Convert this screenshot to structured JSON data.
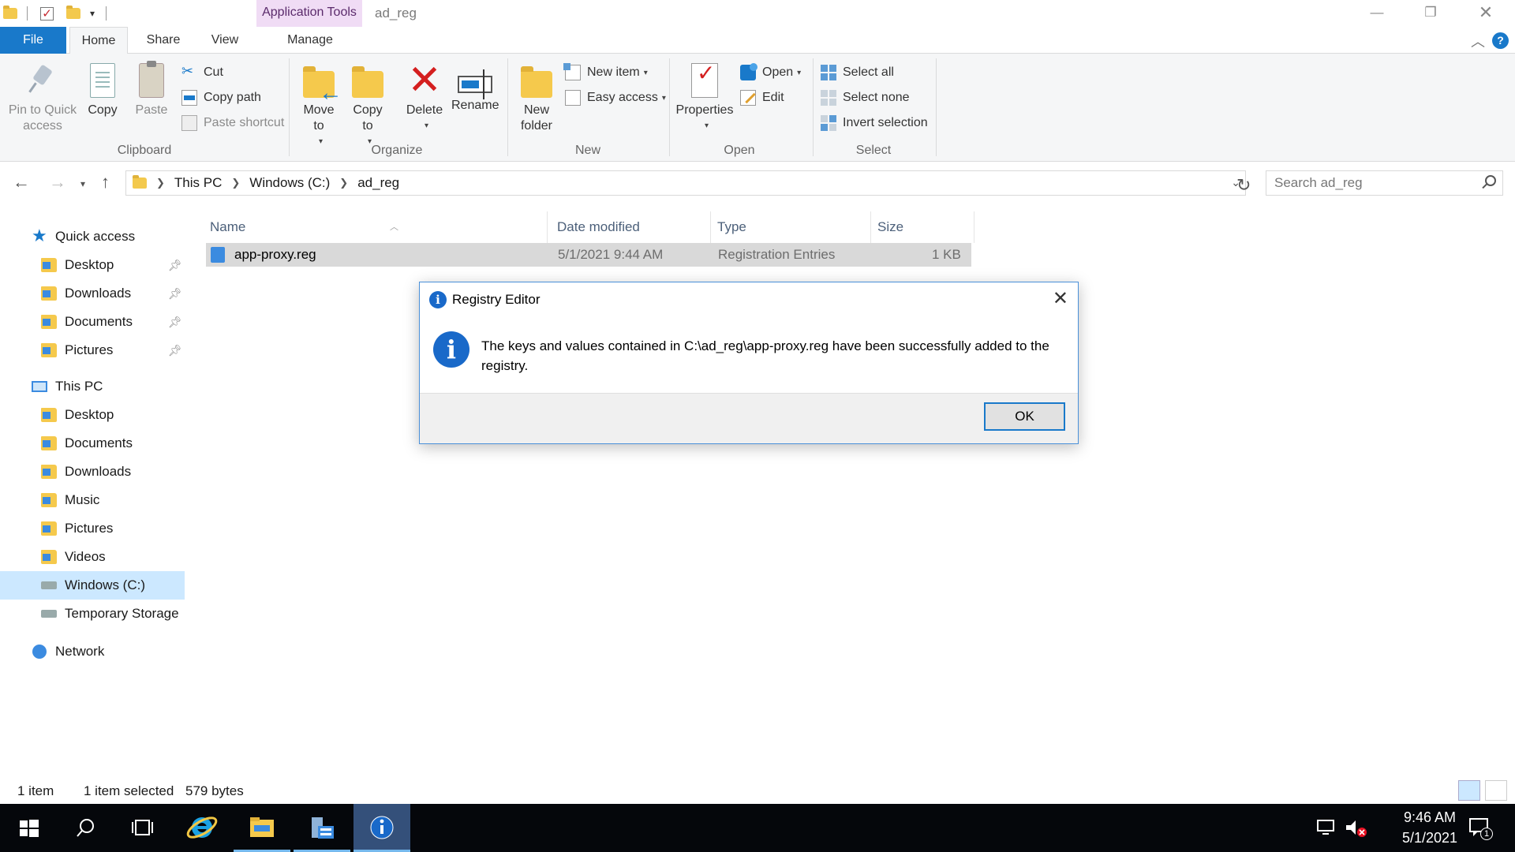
{
  "title_bar": {
    "contextual_tab": "Application Tools",
    "window_title": "ad_reg",
    "buttons": [
      "minimize",
      "maximize",
      "close"
    ]
  },
  "tabs": {
    "file": "File",
    "home": "Home",
    "share": "Share",
    "view": "View",
    "manage": "Manage"
  },
  "ribbon": {
    "clipboard": {
      "label": "Clipboard",
      "pin": "Pin to Quick\naccess",
      "copy": "Copy",
      "paste": "Paste",
      "cut": "Cut",
      "copy_path": "Copy path",
      "paste_shortcut": "Paste shortcut"
    },
    "organize": {
      "label": "Organize",
      "move_to": "Move\nto",
      "copy_to": "Copy\nto",
      "delete": "Delete",
      "rename": "Rename"
    },
    "new": {
      "label": "New",
      "new_folder": "New\nfolder",
      "new_item": "New item",
      "easy_access": "Easy access"
    },
    "open": {
      "label": "Open",
      "properties": "Properties",
      "open": "Open",
      "edit": "Edit"
    },
    "select": {
      "label": "Select",
      "select_all": "Select all",
      "select_none": "Select none",
      "invert": "Invert selection"
    }
  },
  "address": {
    "crumbs": [
      "This PC",
      "Windows (C:)",
      "ad_reg"
    ],
    "search_placeholder": "Search ad_reg"
  },
  "nav": {
    "quick_access": "Quick access",
    "quick_items": [
      "Desktop",
      "Downloads",
      "Documents",
      "Pictures"
    ],
    "this_pc": "This PC",
    "pc_items": [
      "Desktop",
      "Documents",
      "Downloads",
      "Music",
      "Pictures",
      "Videos",
      "Windows (C:)",
      "Temporary Storage"
    ],
    "network": "Network"
  },
  "filelist": {
    "columns": [
      "Name",
      "Date modified",
      "Type",
      "Size"
    ],
    "rows": [
      {
        "name": "app-proxy.reg",
        "date": "5/1/2021 9:44 AM",
        "type": "Registration Entries",
        "size": "1 KB"
      }
    ]
  },
  "dialog": {
    "title": "Registry Editor",
    "message": "The keys and values contained in C:\\ad_reg\\app-proxy.reg have been successfully added to the registry.",
    "ok": "OK"
  },
  "status": {
    "count": "1 item",
    "selection": "1 item selected",
    "size": "579 bytes"
  },
  "taskbar": {
    "time": "9:46 AM",
    "date": "5/1/2021",
    "notification_count": "1"
  },
  "colors": {
    "accent": "#1979ca",
    "selection": "#cce8ff",
    "contextual_tab": "#f0dcf5"
  }
}
